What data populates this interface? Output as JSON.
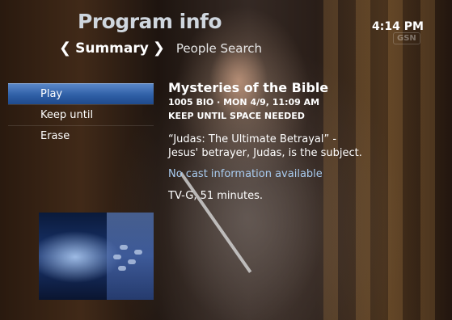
{
  "header": {
    "title": "Program info",
    "clock": "4:14 PM"
  },
  "tabs": {
    "prev_arrow": "❮",
    "active": "Summary",
    "next_arrow": "❯",
    "inactive": "People Search"
  },
  "channel_logo": "GSN",
  "menu": {
    "items": [
      {
        "label": "Play"
      },
      {
        "label": "Keep until"
      },
      {
        "label": "Erase"
      }
    ]
  },
  "program": {
    "title": "Mysteries of the Bible",
    "meta": "1005 BIO  ·  MON 4/9, 11:09 AM",
    "keep": "KEEP UNTIL SPACE NEEDED",
    "description": "“Judas: The Ultimate Betrayal” - Jesus' betrayer, Judas, is the subject.",
    "cast": "No cast information available",
    "rating": "TV-G, 51 minutes."
  },
  "colors": {
    "selected_item": "#2f5fa6",
    "cast_link": "#a9ccf0"
  }
}
